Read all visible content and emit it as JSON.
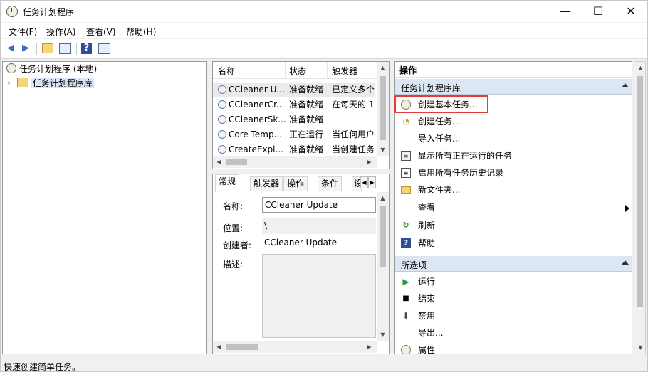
{
  "window": {
    "title": "任务计划程序",
    "minimize_glyph": "—",
    "maximize_glyph": "☐",
    "close_glyph": "✕"
  },
  "menu": [
    "文件(F)",
    "操作(A)",
    "查看(V)",
    "帮助(H)"
  ],
  "toolbar": {
    "icons": [
      "back-icon",
      "forward-icon",
      "folder-up-icon",
      "show-hide-console-tree-icon",
      "help-icon",
      "show-hide-action-pane-icon"
    ]
  },
  "tree": {
    "root": "任务计划程序 (本地)",
    "child": "任务计划程序库",
    "expander": "›"
  },
  "task_list": {
    "columns": [
      "名称",
      "状态",
      "触发器"
    ],
    "rows": [
      {
        "name": "CCleaner U...",
        "status": "准备就绪",
        "trigger": "已定义多个"
      },
      {
        "name": "CCleanerCr...",
        "status": "准备就绪",
        "trigger": "在每天的 1("
      },
      {
        "name": "CCleanerSk...",
        "status": "准备就绪",
        "trigger": ""
      },
      {
        "name": "Core Temp...",
        "status": "正在运行",
        "trigger": "当任何用户..."
      },
      {
        "name": "CreateExpl...",
        "status": "准备就绪",
        "trigger": "当创建任务..."
      }
    ]
  },
  "detail": {
    "tabs": [
      "常规",
      "触发器",
      "操作",
      "条件",
      "设"
    ],
    "labels": {
      "name": "名称:",
      "location": "位置:",
      "author": "创建者:",
      "description": "描述:"
    },
    "values": {
      "name": "CCleaner Update",
      "location": "\\",
      "author": "CCleaner Update",
      "description": ""
    }
  },
  "actions": {
    "title": "操作",
    "section1": "任务计划程序库",
    "items1": [
      "创建基本任务...",
      "创建任务...",
      "导入任务...",
      "显示所有正在运行的任务",
      "启用所有任务历史记录",
      "新文件夹...",
      "查看",
      "刷新",
      "帮助"
    ],
    "section2": "所选项",
    "items2": [
      "运行",
      "结束",
      "禁用",
      "导出...",
      "属性"
    ]
  },
  "status": "快速创建简单任务。",
  "colors": {
    "highlight": "#e23b3b",
    "section_bg": "#dde6f3"
  }
}
